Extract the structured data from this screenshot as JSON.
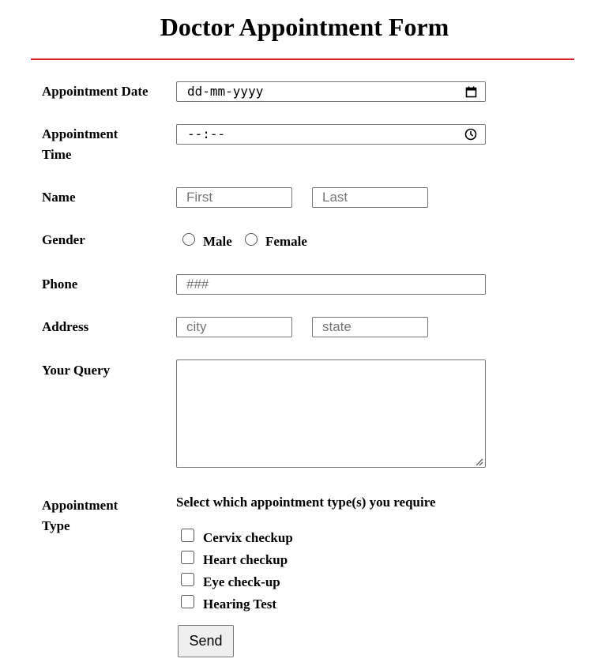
{
  "form": {
    "title": "Doctor Appointment Form",
    "accent_color": "#d9242b",
    "date": {
      "label": "Appointment Date",
      "value": "dd-mm-yyyy",
      "icon": "calendar-icon"
    },
    "time": {
      "label_line1": "Appointment",
      "label_line2": "Time",
      "value": "--:--",
      "icon": "clock-icon"
    },
    "name": {
      "label": "Name",
      "first_placeholder": "First",
      "last_placeholder": "Last"
    },
    "gender": {
      "label": "Gender",
      "options": [
        "Male",
        "Female"
      ]
    },
    "phone": {
      "label": "Phone",
      "placeholder": "###"
    },
    "address": {
      "label": "Address",
      "city_placeholder": "city",
      "state_placeholder": "state"
    },
    "query": {
      "label": "Your Query",
      "value": ""
    },
    "appointment_type": {
      "label_line1": "Appointment",
      "label_line2": "Type",
      "instruction": "Select which appointment type(s) you require",
      "options": [
        "Cervix checkup",
        "Heart checkup",
        "Eye check-up",
        "Hearing Test"
      ]
    },
    "submit_label": "Send"
  }
}
